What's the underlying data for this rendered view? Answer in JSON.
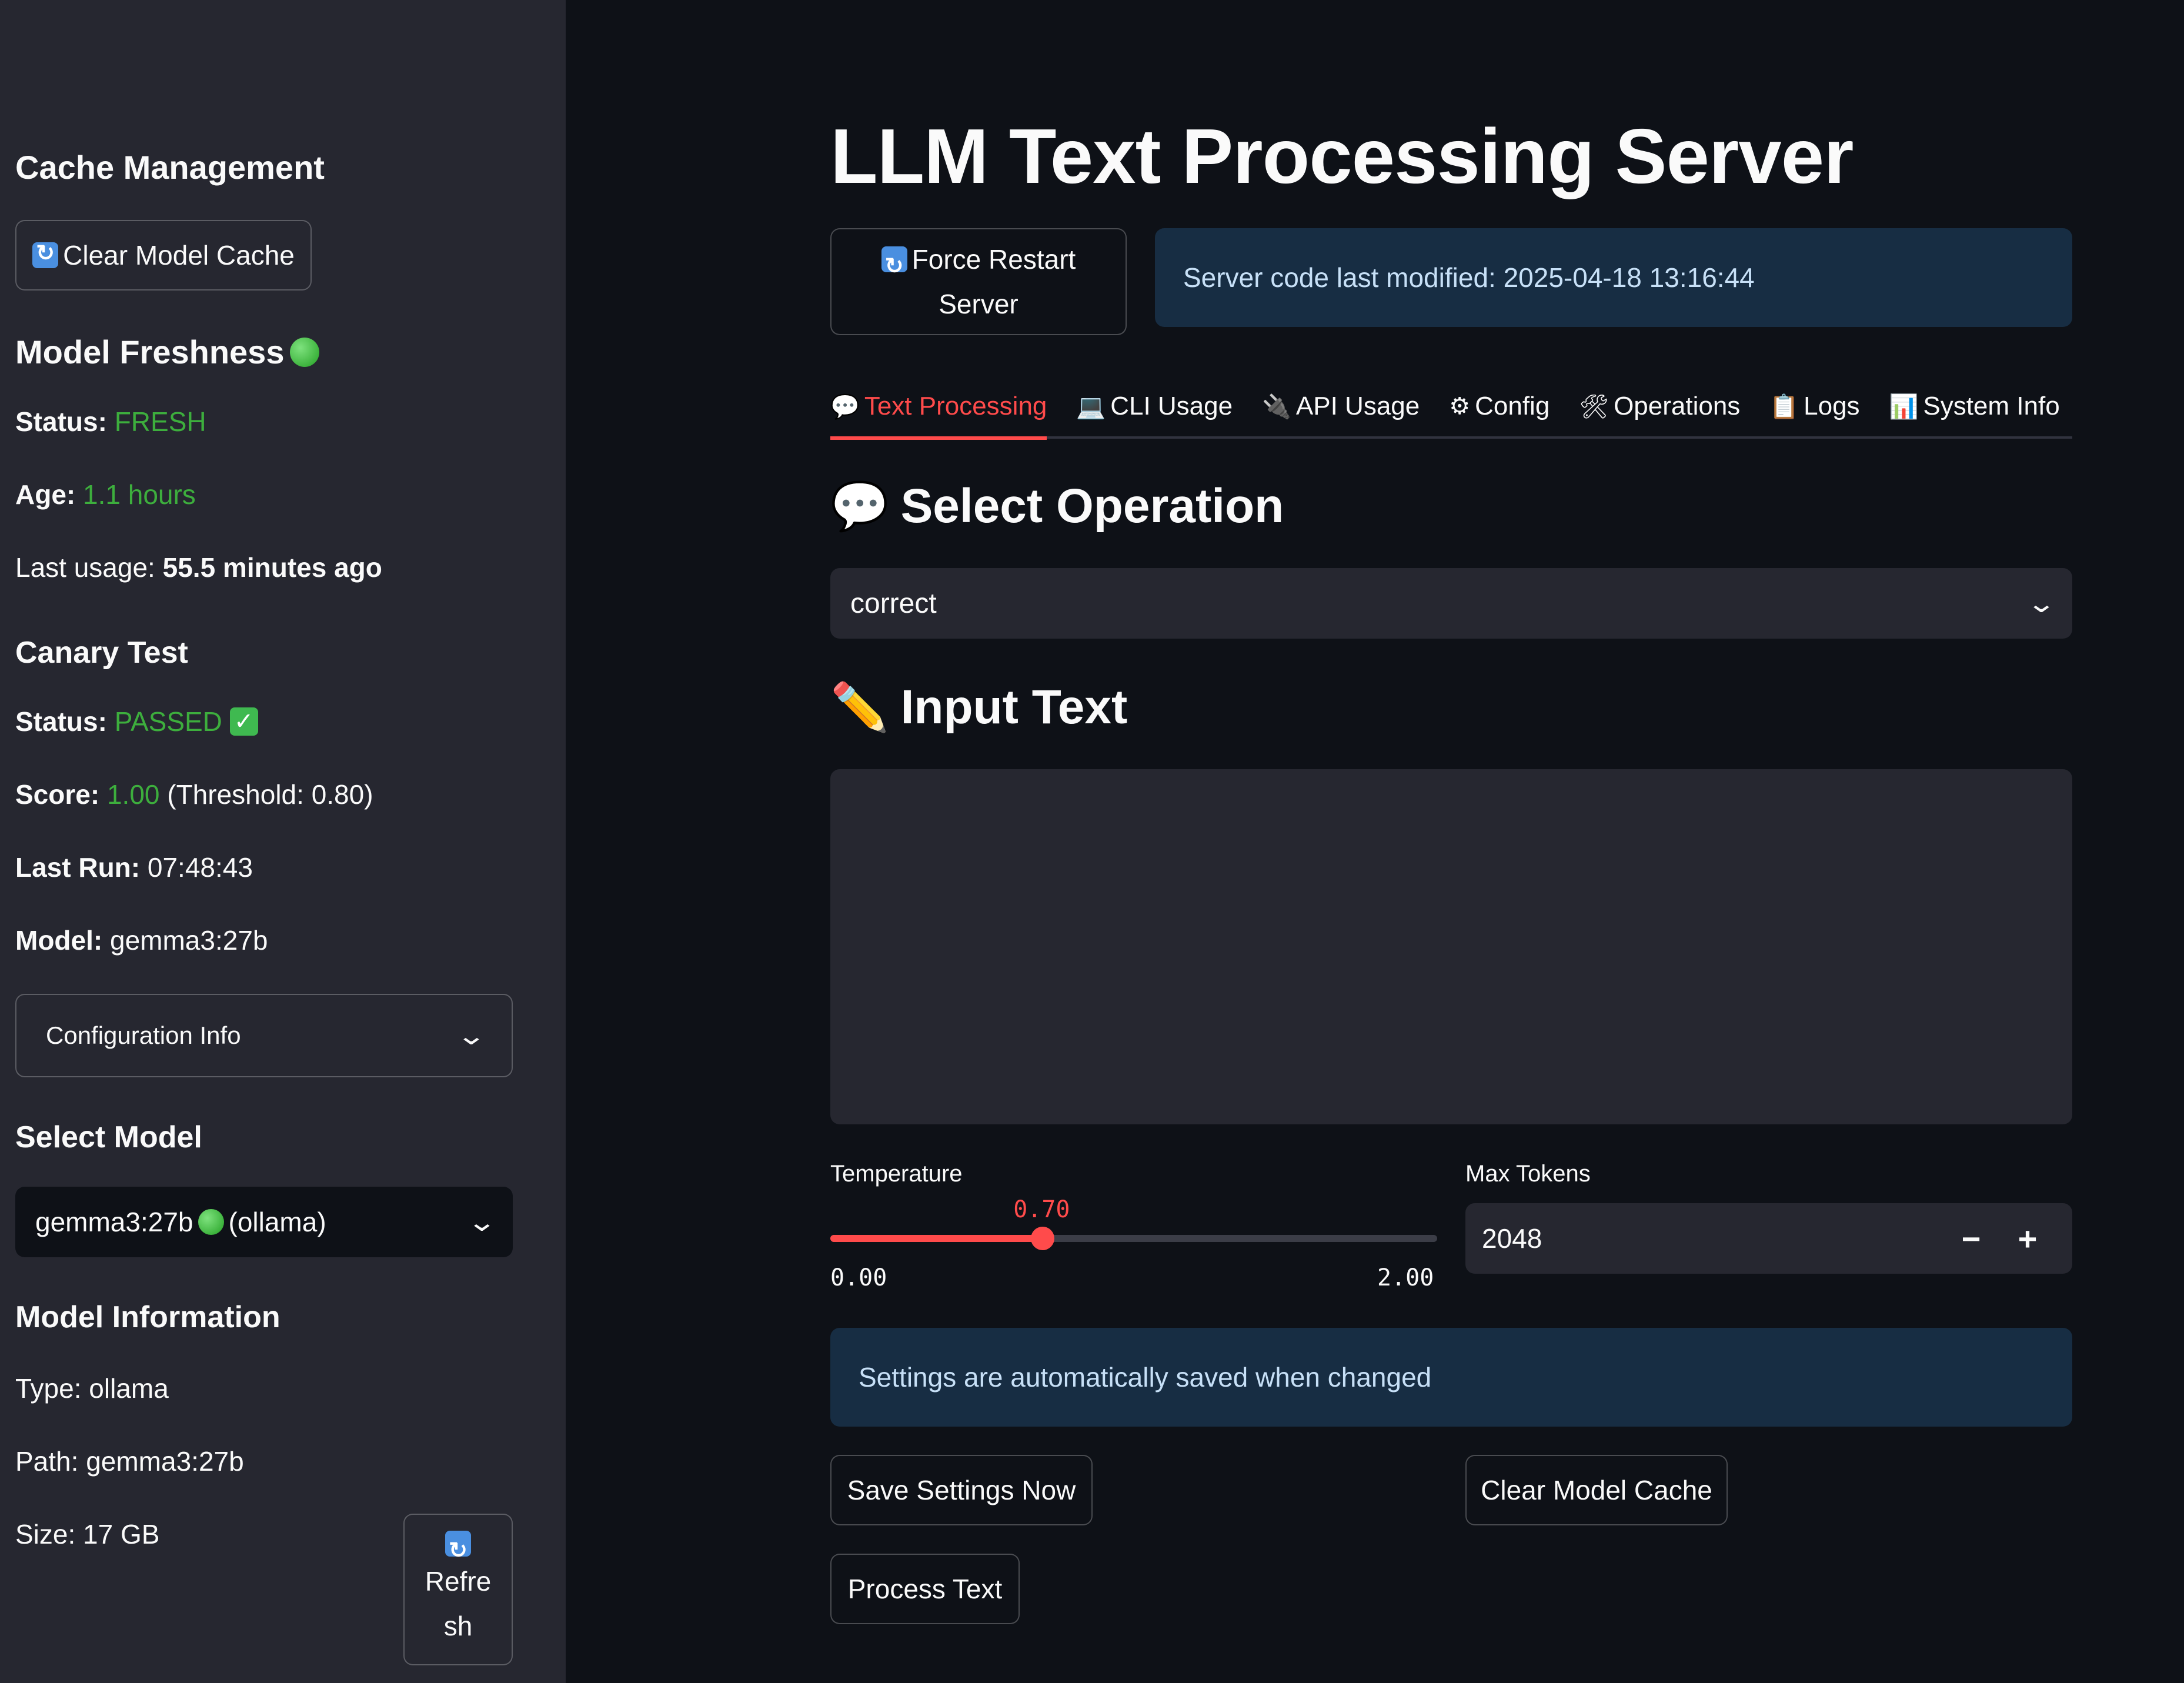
{
  "sidebar": {
    "cache_heading": "Cache Management",
    "clear_cache_button": "Clear Model Cache",
    "freshness_heading": "Model Freshness",
    "freshness_status_label": "Status:",
    "freshness_status_value": "FRESH",
    "age_label": "Age:",
    "age_value": "1.1 hours",
    "last_usage_label": "Last usage:",
    "last_usage_value": "55.5 minutes ago",
    "canary_heading": "Canary Test",
    "canary_status_label": "Status:",
    "canary_status_value": "PASSED",
    "score_label": "Score:",
    "score_value": "1.00",
    "score_threshold": "(Threshold: 0.80)",
    "last_run_label": "Last Run:",
    "last_run_value": "07:48:43",
    "model_label": "Model:",
    "model_value": "gemma3:27b",
    "config_expander": "Configuration Info",
    "select_model_heading": "Select Model",
    "select_model_value_name": "gemma3:27b",
    "select_model_value_suffix": "(ollama)",
    "model_info_heading": "Model Information",
    "type_text": "Type: ollama",
    "path_text": "Path: gemma3:27b",
    "size_text": "Size: 17 GB",
    "refresh_label_line1": "Refre",
    "refresh_label_line2": "sh"
  },
  "main": {
    "title": "LLM Text Processing Server",
    "force_restart_line1": "Force Restart",
    "force_restart_line2": "Server",
    "server_modified": "Server code last modified: 2025-04-18 13:16:44",
    "tabs": [
      {
        "label": "Text Processing",
        "icon": "speech-bubble-icon",
        "glyph": "💬"
      },
      {
        "label": "CLI Usage",
        "icon": "laptop-icon",
        "glyph": "💻"
      },
      {
        "label": "API Usage",
        "icon": "plug-icon",
        "glyph": "🔌"
      },
      {
        "label": "Config",
        "icon": "gear-icon",
        "glyph": "⚙"
      },
      {
        "label": "Operations",
        "icon": "tools-icon",
        "glyph": "🛠"
      },
      {
        "label": "Logs",
        "icon": "clipboard-icon",
        "glyph": "📋"
      },
      {
        "label": "System Info",
        "icon": "bar-chart-icon",
        "glyph": "📊"
      }
    ],
    "select_operation_heading": "Select Operation",
    "operation_value": "correct",
    "input_text_heading": "Input Text",
    "input_text_value": "",
    "temperature_label": "Temperature",
    "temperature_value": "0.70",
    "temperature_value_num": 0.7,
    "temperature_min": "0.00",
    "temperature_max": "2.00",
    "max_tokens_label": "Max Tokens",
    "max_tokens_value": "2048",
    "stepper_minus": "−",
    "stepper_plus": "+",
    "autosave_info": "Settings are automatically saved when changed",
    "save_settings_button": "Save Settings Now",
    "clear_cache_button": "Clear Model Cache",
    "process_text_button": "Process Text"
  },
  "colors": {
    "accent": "#ff4b4b",
    "success": "#3dae3d",
    "info_bg": "#172d43"
  }
}
